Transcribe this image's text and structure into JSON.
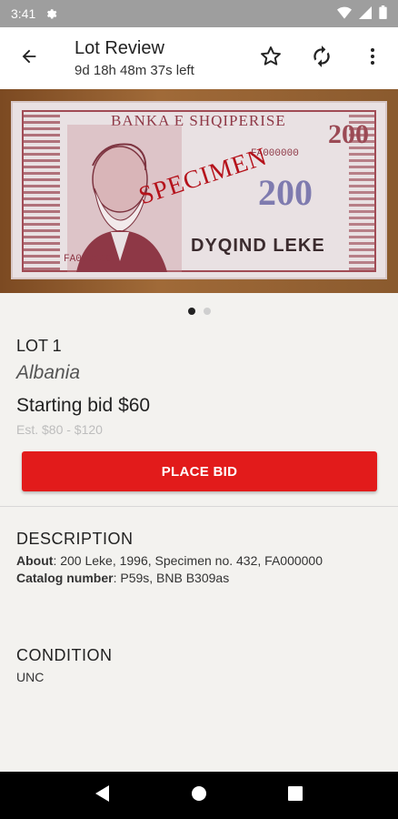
{
  "status_bar": {
    "time": "3:41"
  },
  "app_bar": {
    "title": "Lot Review",
    "subtitle": "9d 18h 48m 37s left"
  },
  "banknote": {
    "bank_name": "BANKA E SHQIPERISE",
    "specimen_text": "SPECIMEN",
    "value": "200",
    "denomination_text": "DYQIND LEKE",
    "serial": "FA000000"
  },
  "lot": {
    "label": "LOT 1",
    "country": "Albania",
    "starting_bid": "Starting bid $60",
    "estimate": "Est. $80 - $120",
    "place_bid_label": "PLACE BID"
  },
  "description": {
    "heading": "DESCRIPTION",
    "about_label": "About",
    "about_value": ": 200 Leke, 1996, Specimen no. 432, FA000000",
    "catalog_label": "Catalog number",
    "catalog_value": ": P59s, BNB B309as"
  },
  "condition": {
    "heading": "CONDITION",
    "value": "UNC"
  },
  "icons": {
    "back": "arrow-back-icon",
    "favorite": "star-outline-icon",
    "refresh": "refresh-icon",
    "more": "more-vert-icon"
  },
  "colors": {
    "accent": "#e21b1b",
    "background": "#f3f2ef",
    "status_bar": "#9e9e9e"
  }
}
